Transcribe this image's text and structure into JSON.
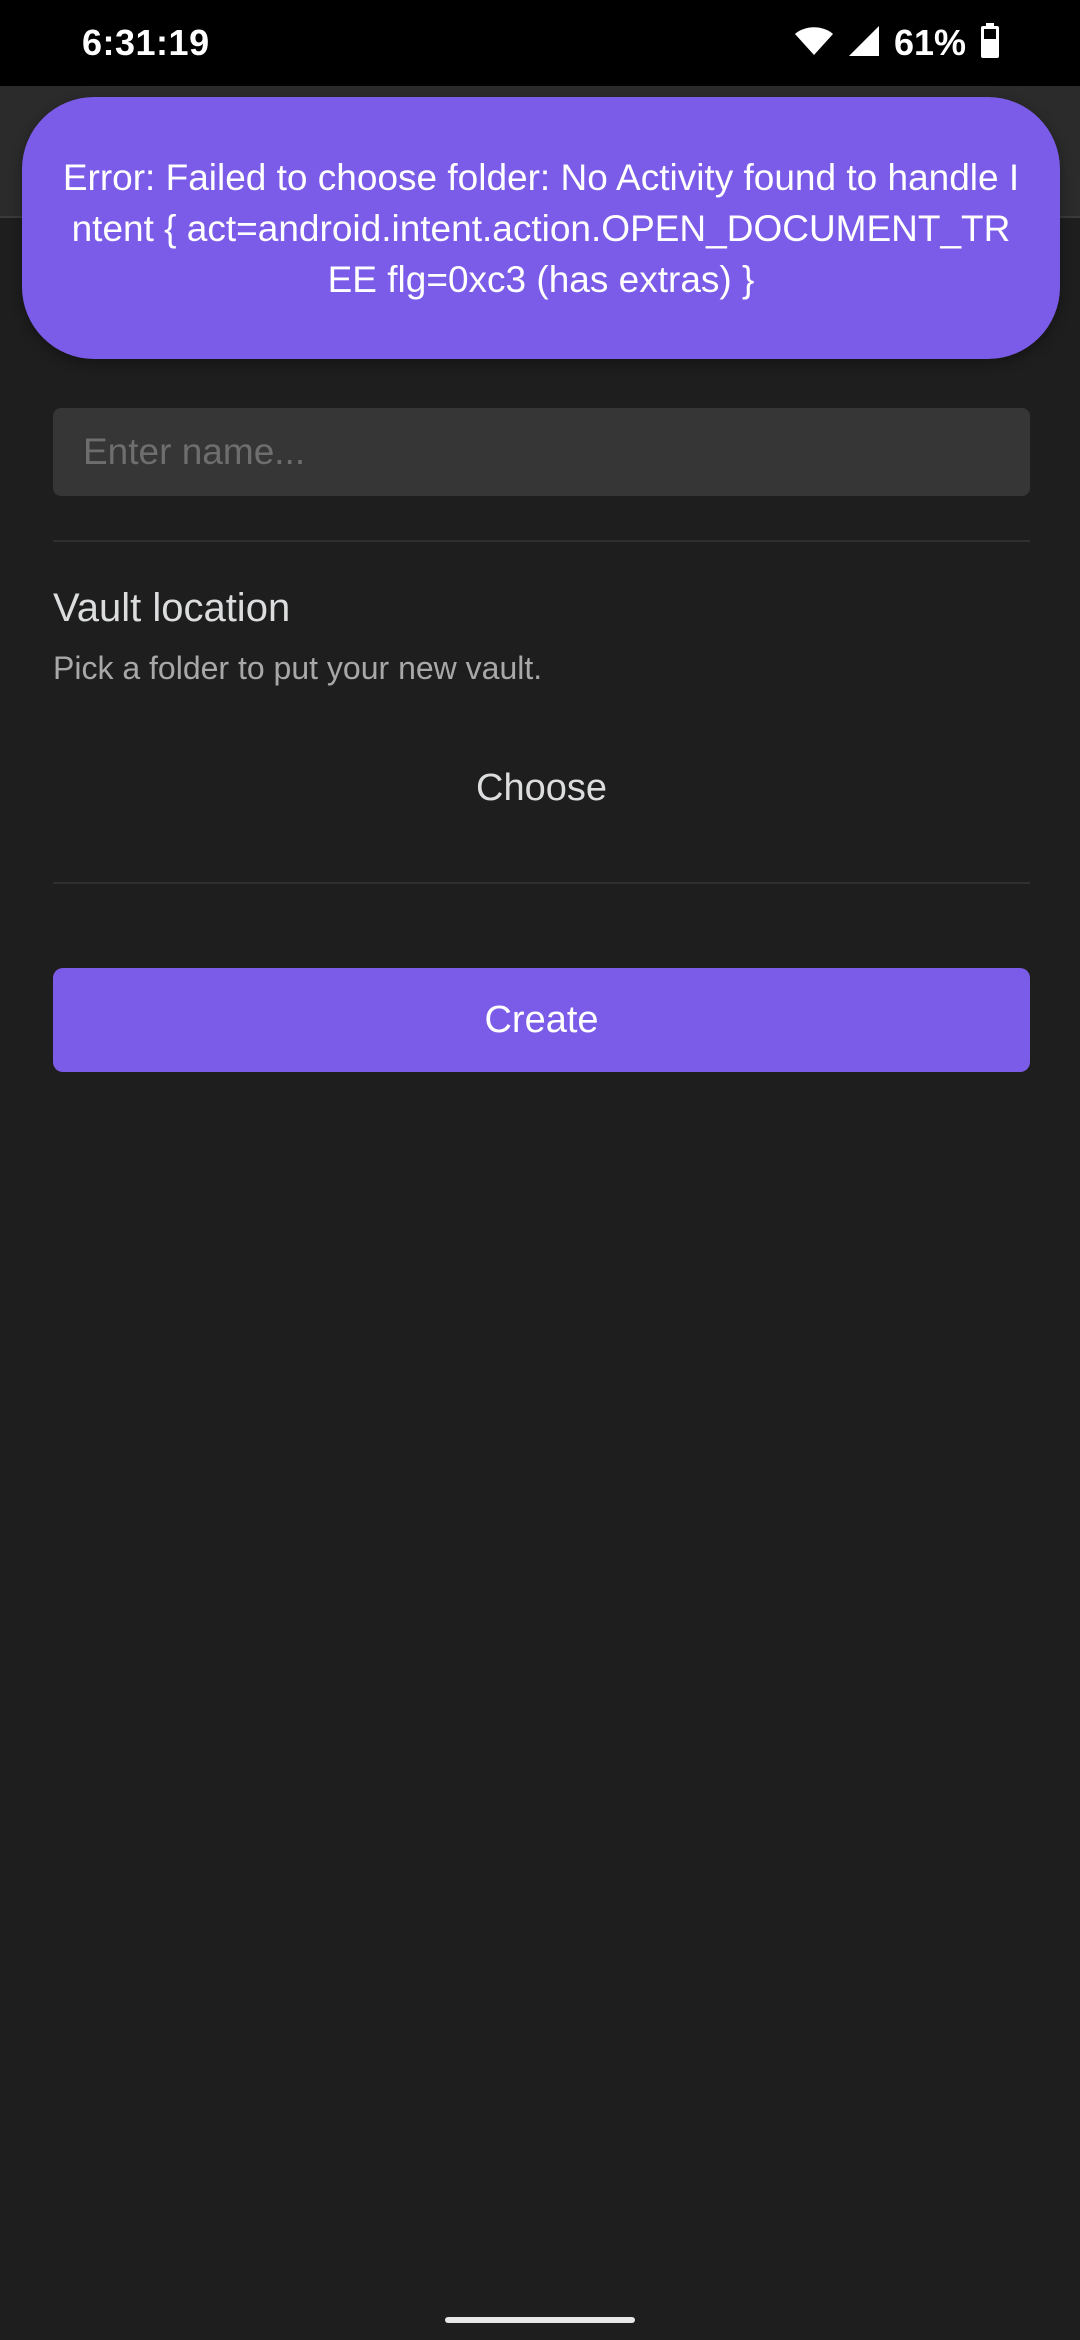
{
  "status_bar": {
    "time": "6:31:19",
    "battery_percent": "61%",
    "icons": [
      "wifi-icon",
      "cell-signal-icon",
      "battery-icon"
    ]
  },
  "form": {
    "name_placeholder": "Enter name...",
    "name_value": "",
    "vault_location_title": "Vault location",
    "vault_location_description": "Pick a folder to put your new vault.",
    "choose_label": "Choose",
    "create_label": "Create"
  },
  "toast": {
    "message": "Error: Failed to choose folder: No Activity found to handle Intent { act=android.intent.action.OPEN_DOCUMENT_TREE flg=0xc3 (has extras) }"
  },
  "colors": {
    "accent": "#7b5ce8",
    "background": "#1e1e1e",
    "input_background": "#363636"
  }
}
